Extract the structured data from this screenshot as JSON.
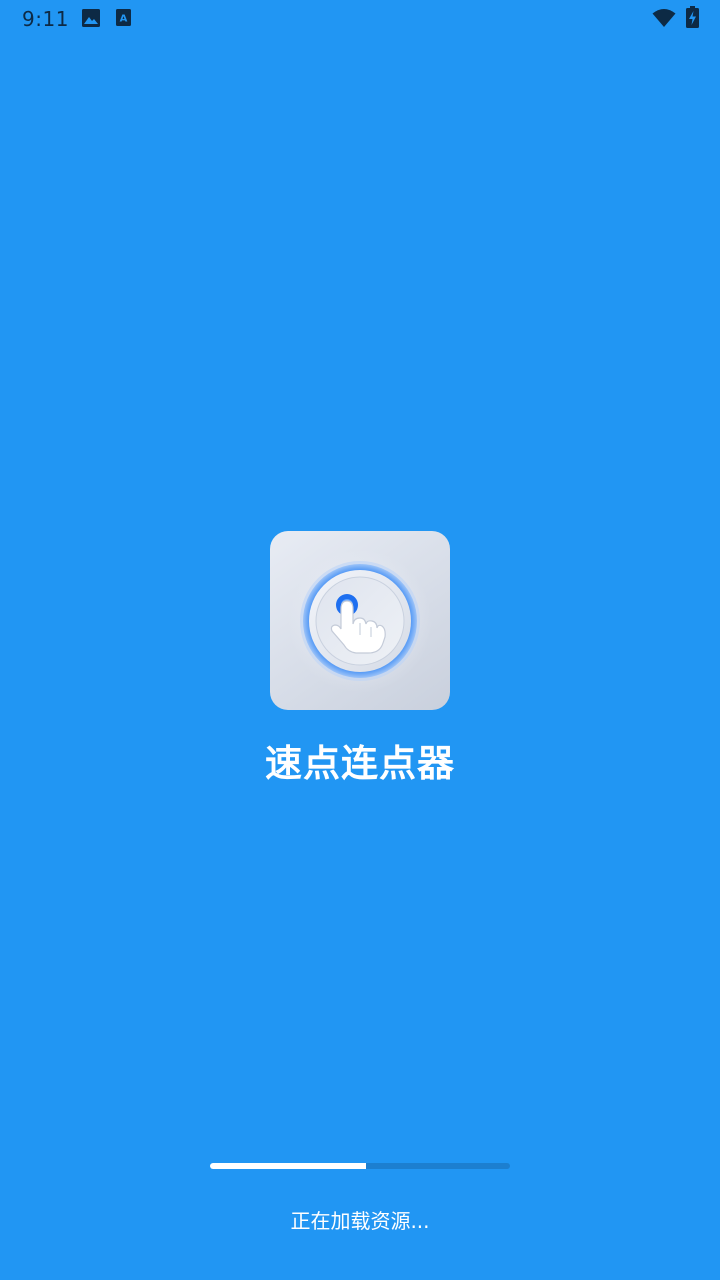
{
  "status_bar": {
    "time": "9:11",
    "icons": [
      "image-icon",
      "text-a-icon",
      "wifi-icon",
      "battery-charging-icon"
    ]
  },
  "splash": {
    "app_name": "速点连点器",
    "app_icon": "tap-finger-icon"
  },
  "loading": {
    "text": "正在加载资源...",
    "progress_fraction": 0.52
  },
  "colors": {
    "background": "#2196F3",
    "progress_track": "#1c7fd0",
    "progress_fill": "#ffffff",
    "title_text": "#ffffff"
  }
}
